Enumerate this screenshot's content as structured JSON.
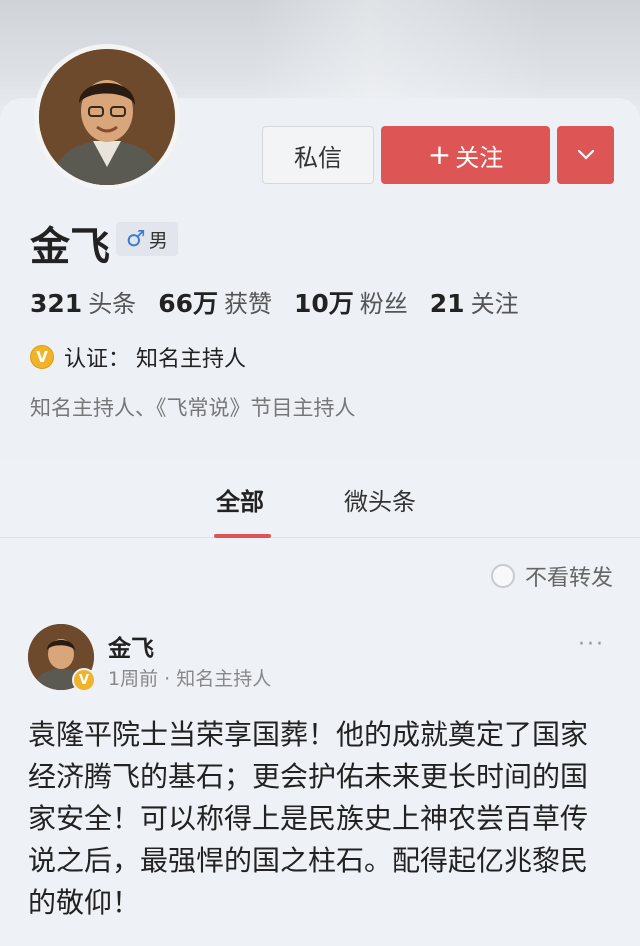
{
  "profile": {
    "name": "金飞",
    "gender_symbol": "♂",
    "gender": "男",
    "buttons": {
      "message": "私信",
      "follow_plus": "+",
      "follow": "关注",
      "more_icon": "chevron-down-icon"
    },
    "stats": [
      {
        "num": "321",
        "label": "头条"
      },
      {
        "num": "66万",
        "label": "获赞"
      },
      {
        "num": "10万",
        "label": "粉丝"
      },
      {
        "num": "21",
        "label": "关注"
      }
    ],
    "verify_badge": "V",
    "verify_prefix": "认证：",
    "verify_text": "知名主持人",
    "bio": "知名主持人、《飞常说》节目主持人"
  },
  "tabs": [
    {
      "label": "全部",
      "active": true
    },
    {
      "label": "微头条",
      "active": false
    }
  ],
  "filter": {
    "label": "不看转发"
  },
  "post": {
    "author": "金飞",
    "badge": "V",
    "meta": "1周前 · 知名主持人",
    "more": "···",
    "body": "袁隆平院士当荣享国葬！他的成就奠定了国家经济腾飞的基石；更会护佑未来更长时间的国家安全！可以称得上是民族史上神农尝百草传说之后，最强悍的国之柱石。配得起亿兆黎民的敬仰！"
  },
  "colors": {
    "accent": "#dd5555",
    "verify_gold": "#f0b42a",
    "background": "#eef1f5"
  }
}
